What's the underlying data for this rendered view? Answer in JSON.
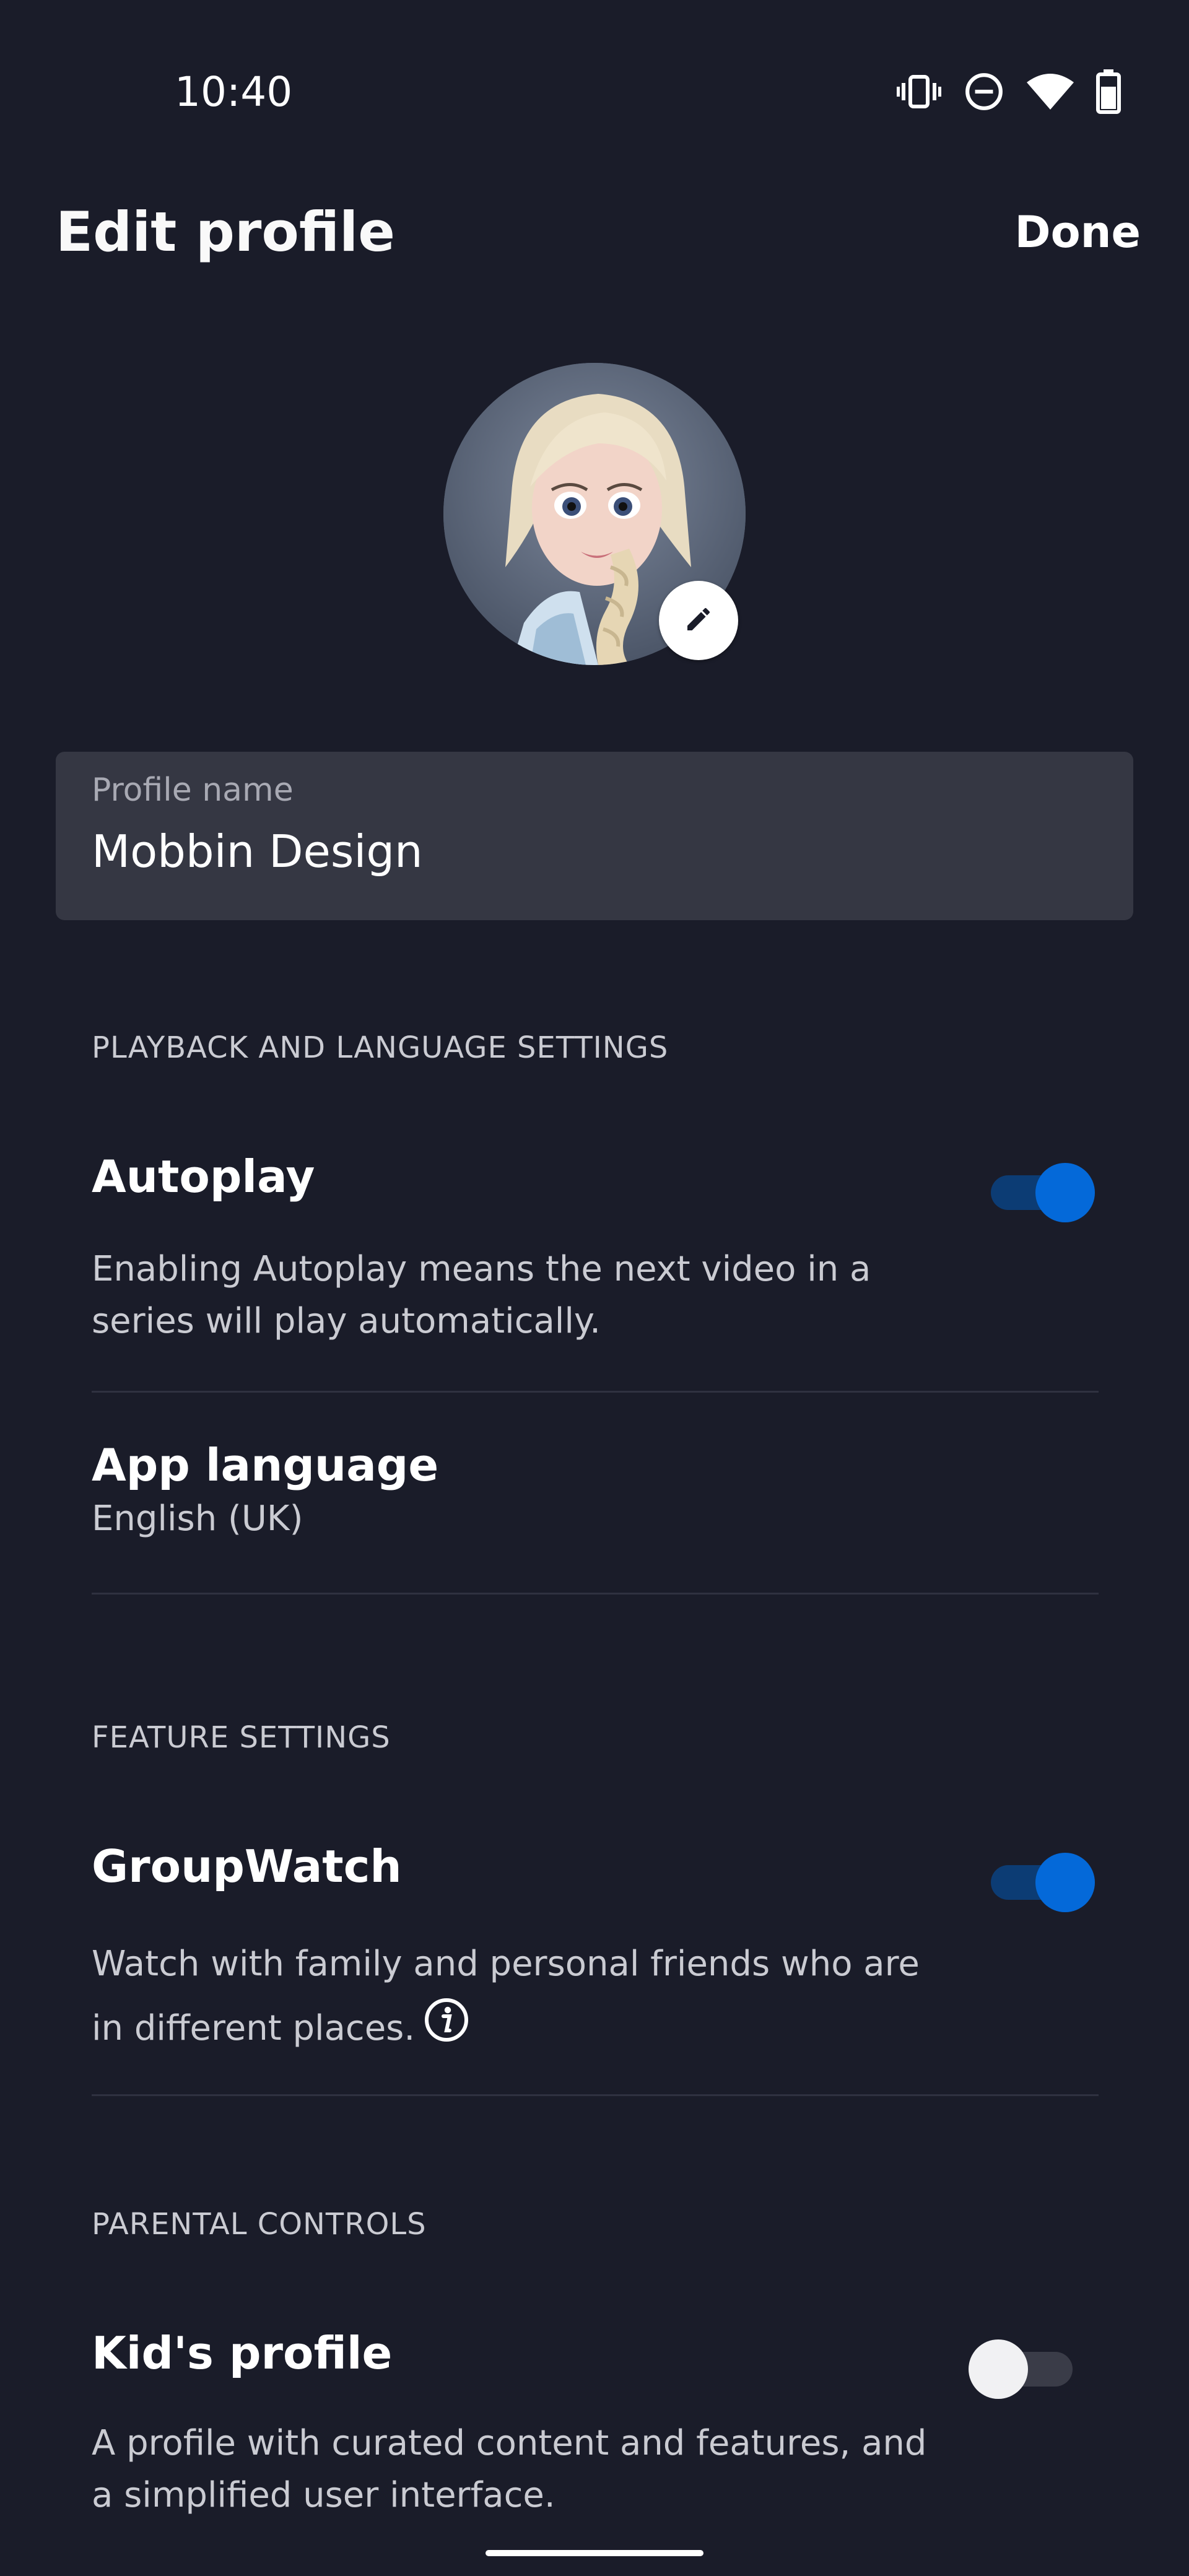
{
  "status_bar": {
    "time": "10:40",
    "icons": [
      "vibrate-icon",
      "do-not-disturb-icon",
      "wifi-icon",
      "battery-icon"
    ]
  },
  "header": {
    "title": "Edit profile",
    "done_label": "Done"
  },
  "avatar": {
    "edit_icon": "pencil-icon"
  },
  "profile_name": {
    "label": "Profile name",
    "value": "Mobbin Design"
  },
  "sections": {
    "playback": {
      "header": "PLAYBACK AND LANGUAGE SETTINGS",
      "autoplay": {
        "title": "Autoplay",
        "description": "Enabling Autoplay means the next video in a series will play automatically.",
        "enabled": true
      },
      "app_language": {
        "title": "App language",
        "value": "English (UK)"
      }
    },
    "features": {
      "header": "FEATURE SETTINGS",
      "groupwatch": {
        "title": "GroupWatch",
        "description": "Watch with family and personal friends who are in different places.",
        "enabled": true,
        "info_icon": "info-icon"
      }
    },
    "parental": {
      "header": "PARENTAL CONTROLS",
      "kids_profile": {
        "title": "Kid's profile",
        "description": "A profile with curated content and features, and a simplified user interface.",
        "enabled": false
      }
    }
  },
  "colors": {
    "background": "#1a1c29",
    "field_background": "#353743",
    "toggle_on": "#0469d9",
    "toggle_on_track": "#0c3c74",
    "toggle_off_thumb": "#f1f1f3",
    "text_primary": "#ffffff",
    "text_secondary": "#cacbd2"
  }
}
